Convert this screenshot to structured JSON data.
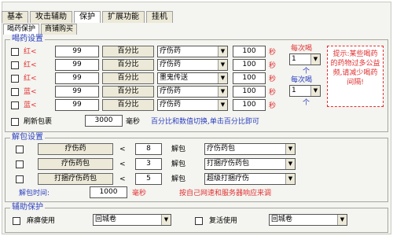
{
  "tabs": [
    "基本",
    "攻击辅助",
    "保护",
    "扩展功能",
    "挂机"
  ],
  "subtabs": [
    "喝药保护",
    "商铺购买"
  ],
  "drink": {
    "title": "喝药设置",
    "rows": [
      {
        "label": "红<",
        "value": "99",
        "mode": "百分比",
        "item": "疗伤药",
        "qty": "100",
        "unit": "秒"
      },
      {
        "label": "红<",
        "value": "99",
        "mode": "百分比",
        "item": "疗伤药",
        "qty": "100",
        "unit": "秒"
      },
      {
        "label": "红<",
        "value": "99",
        "mode": "百分比",
        "item": "墨鬼传送",
        "qty": "100",
        "unit": "秒"
      },
      {
        "label": "蓝<",
        "value": "99",
        "mode": "百分比",
        "item": "疗伤药",
        "qty": "100",
        "unit": "秒"
      },
      {
        "label": "蓝<",
        "value": "99",
        "mode": "百分比",
        "item": "疗伤药",
        "qty": "100",
        "unit": "秒"
      }
    ],
    "each_label_1": "每次喝",
    "each_value_1": "1",
    "each_unit_1": "个",
    "each_label_2": "每次喝",
    "each_value_2": "1",
    "each_unit_2": "个",
    "note": "提示:某些喝药的药物过多公益频,请减少喝药间隔!",
    "refresh_label": "刷新包裹",
    "refresh_value": "3000",
    "refresh_unit": "毫秒",
    "refresh_hint": "百分比和数值切换,单击百分比即可"
  },
  "unpack": {
    "title": "解包设置",
    "rows": [
      {
        "item": "疗伤药",
        "op": "<",
        "num": "8",
        "action": "解包",
        "pkg": "疗伤药包"
      },
      {
        "item": "疗伤药包",
        "op": "<",
        "num": "3",
        "action": "解包",
        "pkg": "打捆疗伤药包"
      },
      {
        "item": "打捆疗伤药包",
        "op": "<",
        "num": "5",
        "action": "解包",
        "pkg": "超级打捆疗伤"
      }
    ],
    "time_label": "解包时间:",
    "time_value": "1000",
    "time_unit": "毫秒",
    "time_hint": "按自己网速和服务器响应来调"
  },
  "assist": {
    "title": "辅助保护",
    "left_label": "麻痹使用",
    "left_sel": "回城卷",
    "right_label": "复活使用",
    "right_sel": "回城卷"
  }
}
